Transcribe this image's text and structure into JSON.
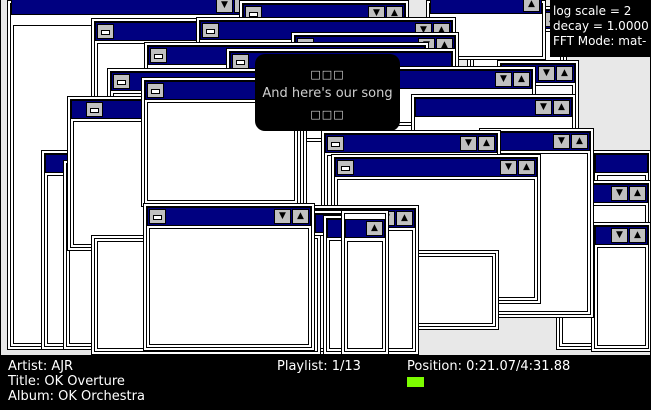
{
  "visualizer": {
    "log_scale_text": "log scale = 2",
    "decay_text": "decay = 1.0000",
    "fft_mode_text": "FFT Mode: mat-"
  },
  "lyrics": {
    "prev_line": "□□□",
    "current_line": "And here's our song",
    "next_line": "□□□"
  },
  "now_playing": {
    "artist_label": "Artist: AJR",
    "title_label": "Title: OK Overture",
    "album_label": "Album: OK Orchestra",
    "playlist_label": "Playlist: 1/13",
    "position_label": "Position: 0:21.07/4:31.88"
  },
  "progress": {
    "color": "#7cfc00"
  },
  "window_chrome": {
    "titlebar_color": "#000080",
    "button_face_color": "#c0c0c0",
    "min_icon": "triangle-down-icon",
    "max_icon": "triangle-up-icon"
  }
}
